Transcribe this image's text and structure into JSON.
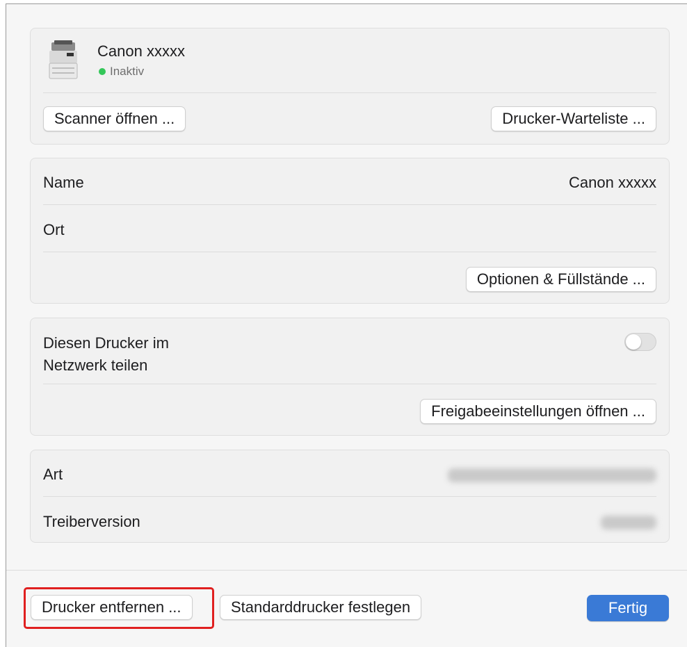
{
  "printer": {
    "name": "Canon xxxxx",
    "status": "Inaktiv",
    "status_color": "#34c759",
    "icon": "printer-icon"
  },
  "top_actions": {
    "scanner_button": "Scanner öffnen ...",
    "queue_button": "Drucker-Warteliste ..."
  },
  "details": {
    "name_label": "Name",
    "name_value": "Canon xxxxx",
    "location_label": "Ort",
    "options_button": "Optionen & Füllstände ..."
  },
  "sharing": {
    "share_label_line1": "Diesen Drucker im",
    "share_label_line2": "Netzwerk teilen",
    "share_enabled": false,
    "settings_button": "Freigabeeinstellungen öffnen ..."
  },
  "info": {
    "kind_label": "Art",
    "driver_label": "Treiberversion"
  },
  "footer": {
    "remove_button": "Drucker entfernen ...",
    "default_button": "Standarddrucker festlegen",
    "done_button": "Fertig",
    "highlight_color": "#e02020",
    "accent_color": "#3a7ad6"
  }
}
